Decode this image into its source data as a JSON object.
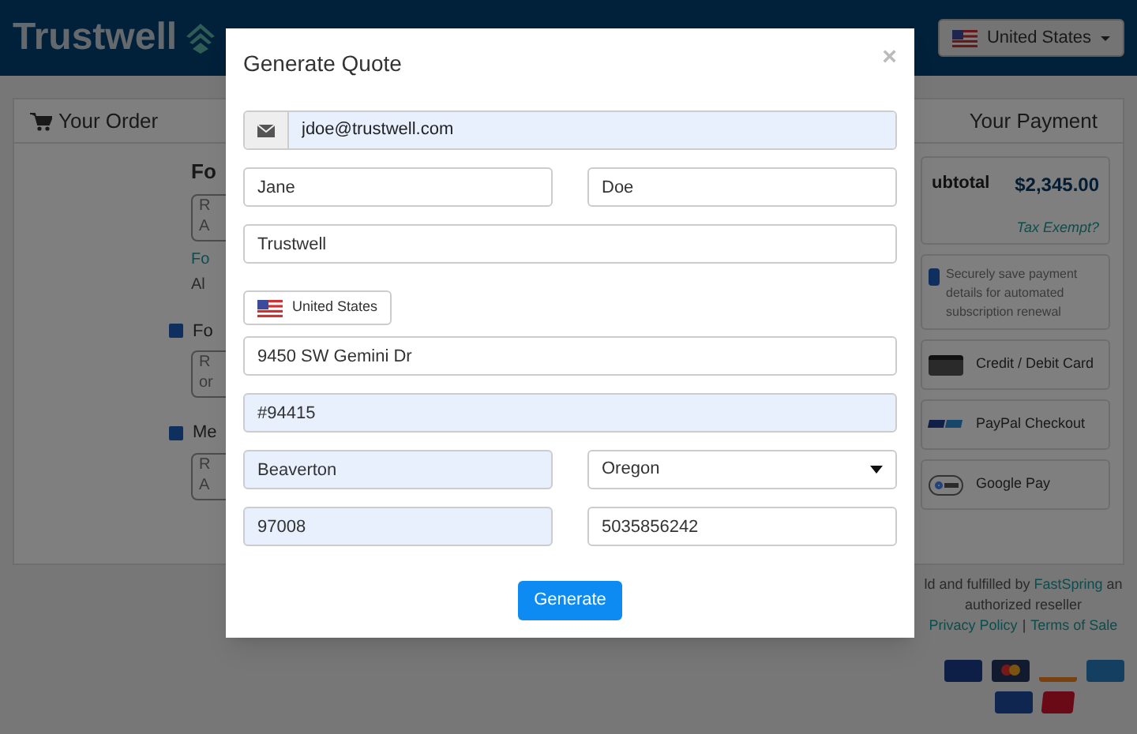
{
  "header": {
    "logo": "Trustwell",
    "country_button": "United States"
  },
  "order": {
    "title": "Your Order",
    "heading": "Fo",
    "items": [
      {
        "kind": "textbox",
        "lines": [
          "R",
          "A"
        ]
      },
      {
        "kind": "link",
        "text": "Fo"
      },
      {
        "kind": "text",
        "text": "Al"
      },
      {
        "kind": "checkbox",
        "text": "Fo",
        "checked": true
      },
      {
        "kind": "textbox",
        "lines": [
          "R",
          "or"
        ]
      },
      {
        "kind": "checkbox",
        "text": "Me",
        "checked": true
      },
      {
        "kind": "textbox",
        "lines": [
          "R",
          "A"
        ]
      }
    ]
  },
  "payment": {
    "title": "Your Payment",
    "subtotal_label": "ubtotal",
    "subtotal": "$2,345.00",
    "tax_link": "Tax Exempt?",
    "save_option": {
      "text": "Securely save payment details for automated subscription renewal",
      "checked": true
    },
    "methods": [
      {
        "kind": "card",
        "label": "Credit / Debit Card"
      },
      {
        "kind": "paypal",
        "label": "PayPal Checkout"
      },
      {
        "kind": "gpay",
        "label": "Google Pay"
      }
    ],
    "reseller": {
      "before": "ld and fulfilled by",
      "link": "FastSpring",
      "after": "an authorized reseller"
    },
    "links": [
      "Privacy Policy",
      "Terms of Sale"
    ],
    "separator": "|"
  },
  "modal": {
    "title": "Generate Quote",
    "close": "×",
    "country": "United States",
    "button": "Generate",
    "rows": [
      [
        {
          "kind": "email",
          "value": "jdoe@trustwell.com",
          "autofilled": true
        }
      ],
      [
        {
          "kind": "text",
          "value": "Jane",
          "autofilled": false
        },
        {
          "kind": "text",
          "value": "Doe",
          "autofilled": false
        }
      ],
      [
        {
          "kind": "text",
          "value": "Trustwell",
          "autofilled": false
        }
      ],
      [
        {
          "kind": "country"
        }
      ],
      [
        {
          "kind": "text",
          "value": "9450 SW Gemini Dr",
          "autofilled": false
        }
      ],
      [
        {
          "kind": "text",
          "value": "#94415",
          "autofilled": true
        }
      ],
      [
        {
          "kind": "text",
          "value": "Beaverton",
          "autofilled": true
        },
        {
          "kind": "select",
          "value": "Oregon",
          "autofilled": false
        }
      ],
      [
        {
          "kind": "text",
          "value": "97008",
          "autofilled": true
        },
        {
          "kind": "text",
          "value": "5035856242",
          "autofilled": false
        }
      ]
    ]
  }
}
